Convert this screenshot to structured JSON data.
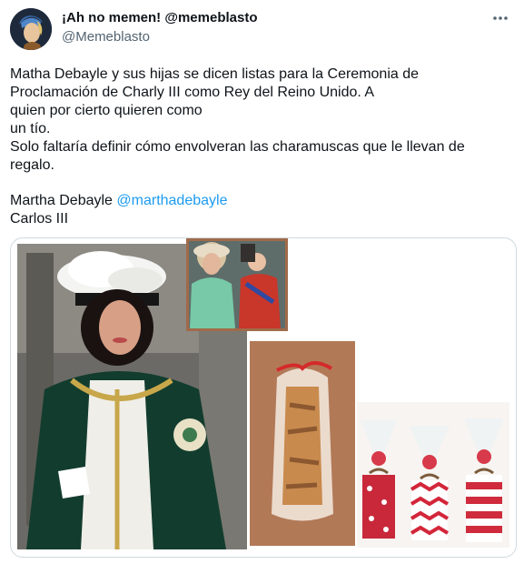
{
  "author": {
    "display_name": "¡Ah no memen! @memeblasto",
    "handle": "@Memeblasto"
  },
  "tweet": {
    "line1": "Matha Debayle y sus hijas se dicen listas para la Ceremonia de",
    "line2": "Proclamación de Charly III como Rey del Reino Unido. A",
    "line3": "quien por cierto quieren como",
    "line4": "un tío.",
    "line5": "Solo faltaría definir cómo envolveran las charamuscas que le llevan de",
    "line6": "regalo.",
    "line7_text": "Martha Debayle ",
    "mention": "@marthadebayle",
    "line8": "Carlos III"
  },
  "icons": {
    "more": "more-dots-icon",
    "avatar": "avatar-portrait"
  },
  "colors": {
    "text": "#0f1419",
    "secondary": "#536471",
    "link": "#1d9bf0",
    "border": "#cfd9de"
  }
}
